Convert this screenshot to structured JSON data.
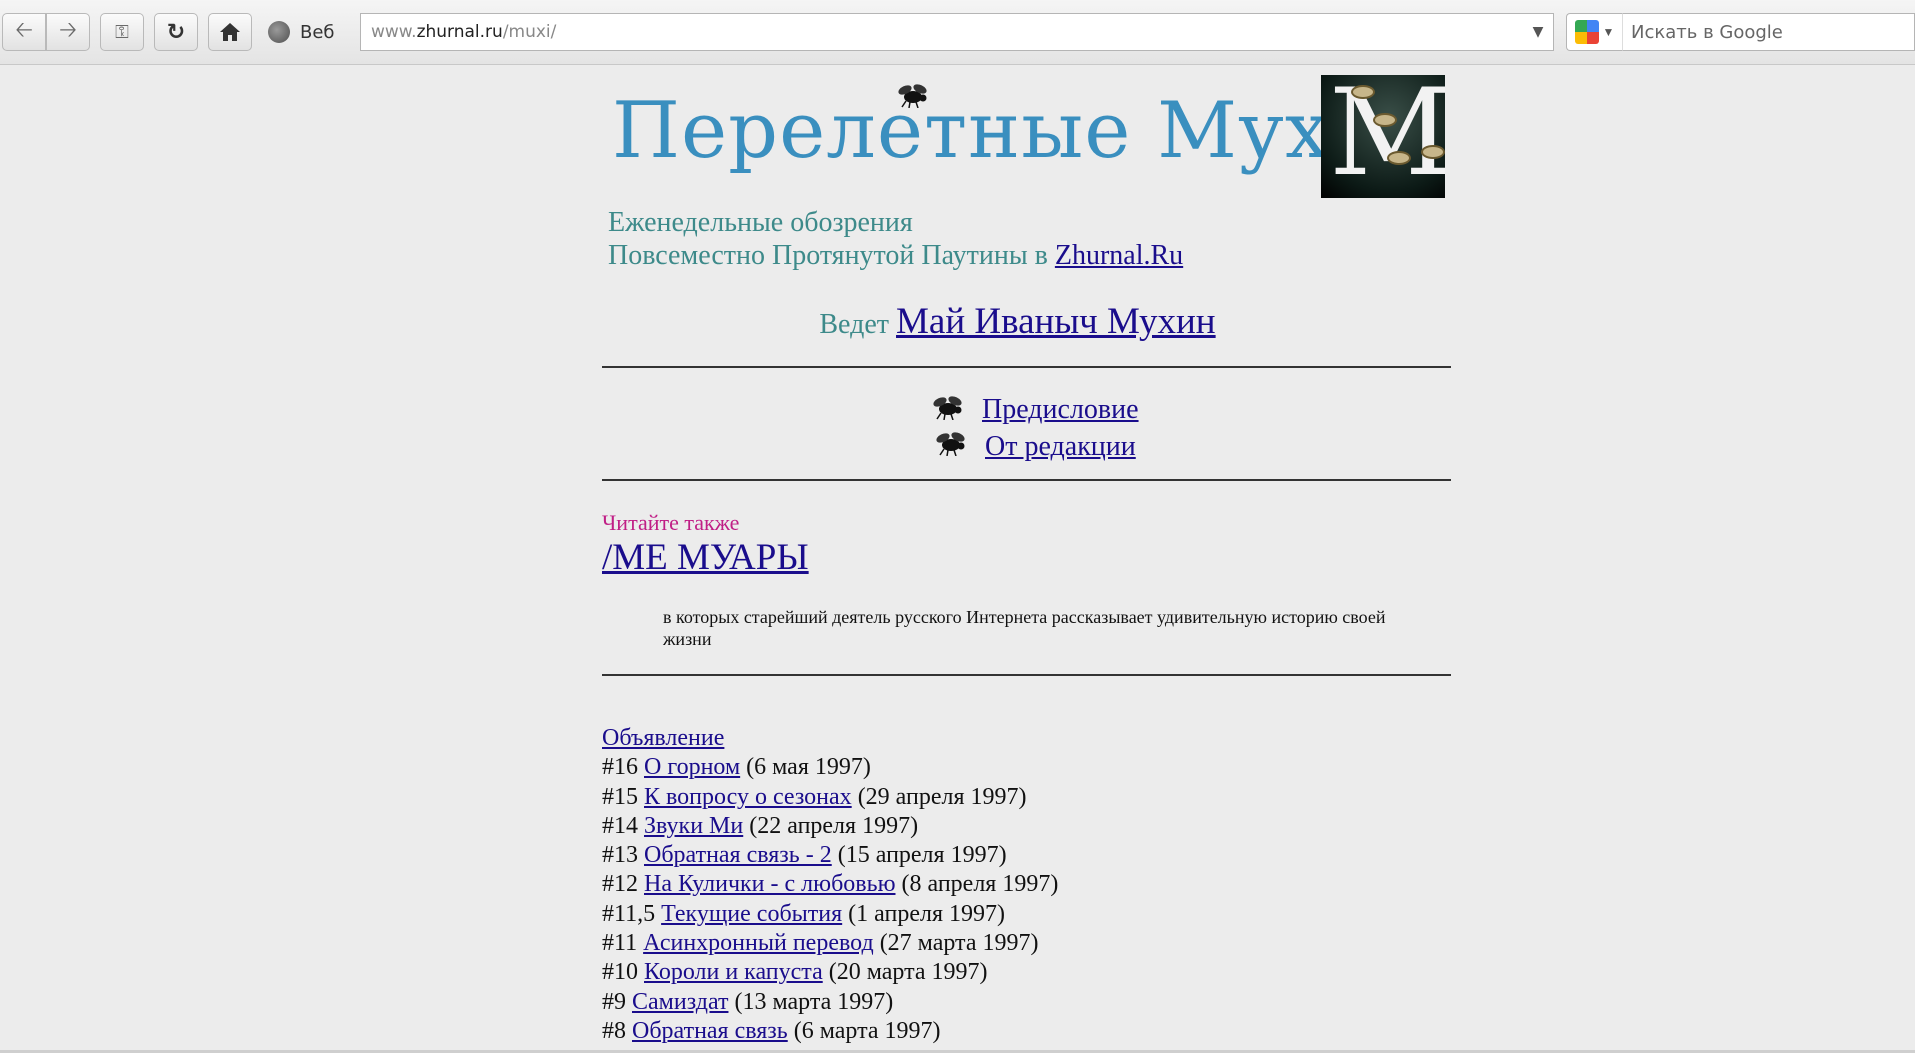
{
  "browser": {
    "home_icon": "home-icon",
    "web_label": "Веб",
    "url_domain": "www.zhurnal.ru",
    "url_prefix": "www.",
    "url_host": "zhurnal.ru",
    "url_path": "/muxi/",
    "search_placeholder": "Искать в Google"
  },
  "header": {
    "title": "Перелетные Мухи",
    "subtitle_line1": "Еженедельные обозрения",
    "subtitle_line2": "Повсеместно Протянутой Паутины в ",
    "subtitle_link": "Zhurnal.Ru",
    "host_prefix": "Ведет ",
    "host_link": "Май Иваныч Мухин"
  },
  "intro": {
    "foreword": "Предисловие",
    "editorial": "От редакции"
  },
  "read_also": {
    "label": "Читайте также",
    "link": "/МЕ МУАРЫ",
    "description": "в которых старейший деятель русского Интернета рассказывает удивительную историю своей жизни"
  },
  "announcement": "Объявление",
  "issues": [
    {
      "num": "#16 ",
      "title": "О горном",
      "date": " (6 мая 1997)"
    },
    {
      "num": "#15 ",
      "title": "К вопросу о сезонах",
      "date": " (29 апреля 1997)"
    },
    {
      "num": "#14 ",
      "title": "Звуки Ми",
      "date": " (22 апреля 1997)"
    },
    {
      "num": "#13 ",
      "title": "Обратная связь - 2",
      "date": " (15 апреля 1997)"
    },
    {
      "num": "#12 ",
      "title": "На Кулички - с любовью",
      "date": " (8 апреля 1997)"
    },
    {
      "num": "#11,5 ",
      "title": "Текущие события",
      "date": " (1 апреля 1997)"
    },
    {
      "num": "#11 ",
      "title": "Асинхронный перевод",
      "date": " (27 марта 1997)"
    },
    {
      "num": "#10 ",
      "title": "Короли и капуста",
      "date": " (20 марта 1997)"
    },
    {
      "num": "#9 ",
      "title": "Самиздат",
      "date": " (13 марта 1997)"
    },
    {
      "num": "#8 ",
      "title": "Обратная связь",
      "date": " (6 марта 1997)"
    }
  ]
}
